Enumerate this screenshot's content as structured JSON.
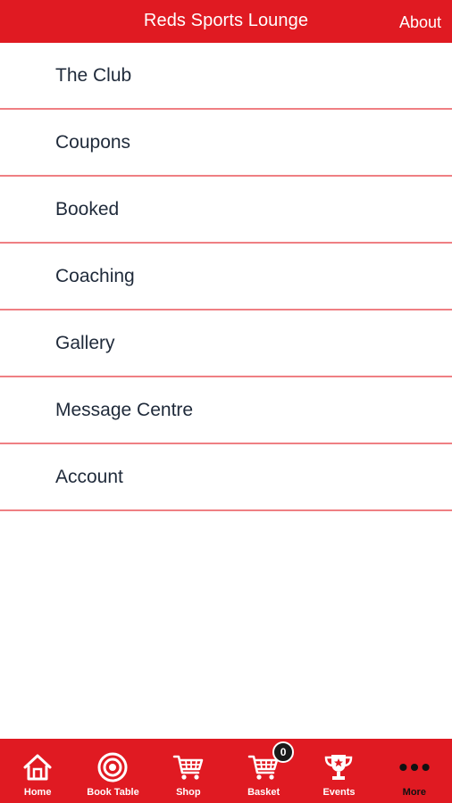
{
  "header": {
    "title": "Reds Sports Lounge",
    "about_label": "About"
  },
  "menu": {
    "items": [
      {
        "label": "The Club"
      },
      {
        "label": "Coupons"
      },
      {
        "label": "Booked"
      },
      {
        "label": "Coaching"
      },
      {
        "label": "Gallery"
      },
      {
        "label": "Message Centre"
      },
      {
        "label": "Account"
      }
    ]
  },
  "tabbar": {
    "tabs": [
      {
        "label": "Home",
        "icon": "home-icon"
      },
      {
        "label": "Book Table",
        "icon": "target-icon"
      },
      {
        "label": "Shop",
        "icon": "shopping-cart-icon"
      },
      {
        "label": "Basket",
        "icon": "basket-cart-icon",
        "badge": "0"
      },
      {
        "label": "Events",
        "icon": "trophy-icon"
      },
      {
        "label": "More",
        "icon": "more-dots-icon",
        "active": true
      }
    ]
  },
  "colors": {
    "brand_red": "#e01a22",
    "divider": "#ef7f83",
    "text": "#1f2a3a"
  }
}
